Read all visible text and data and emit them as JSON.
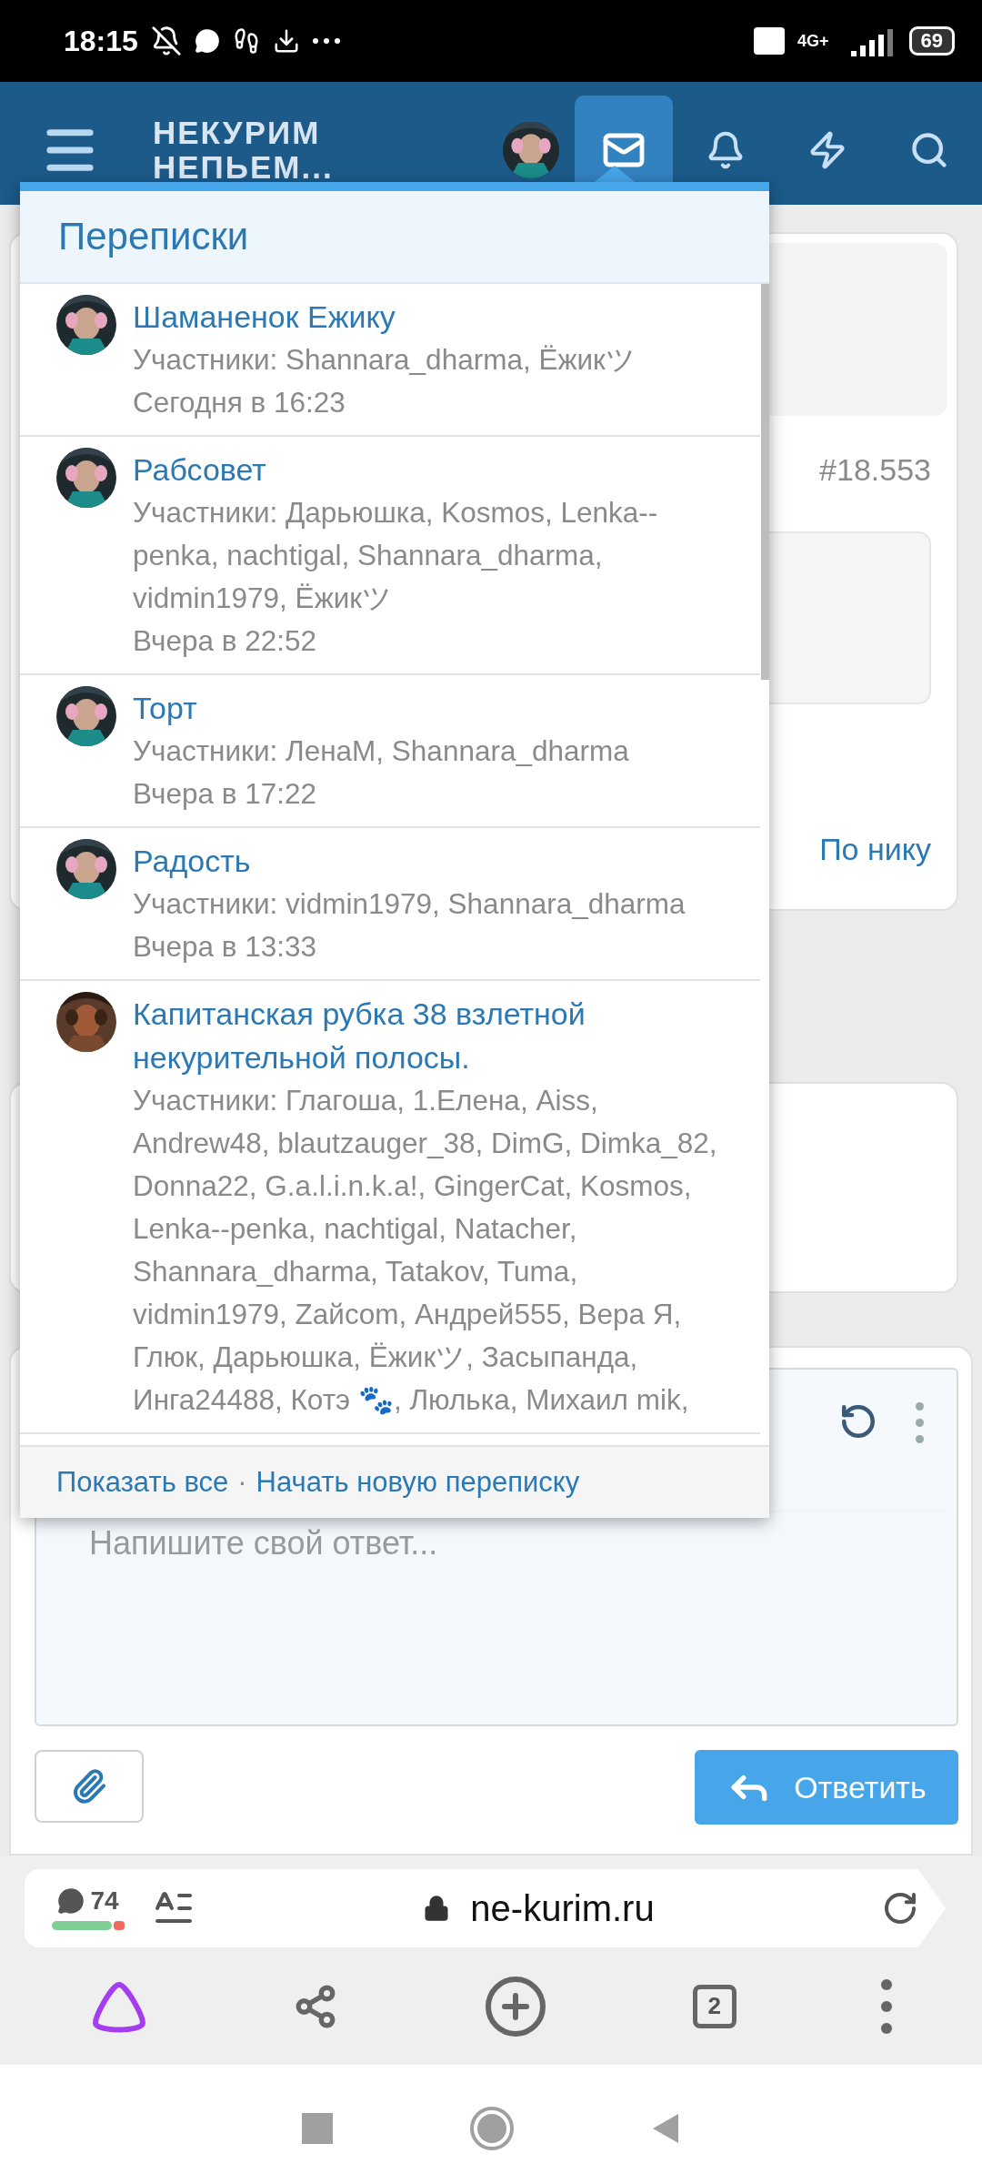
{
  "status_bar": {
    "time": "18:15",
    "network": "4G+",
    "battery": "69"
  },
  "header": {
    "logo_lines": [
      "НЕКУРИМ",
      "НЕПЬЕМ..."
    ],
    "nav": [
      {
        "kind": "avatar",
        "selected": false
      },
      {
        "kind": "mail",
        "selected": true
      },
      {
        "kind": "bell",
        "selected": false
      },
      {
        "kind": "bolt",
        "selected": false
      },
      {
        "kind": "search",
        "selected": false
      }
    ]
  },
  "page": {
    "post_number": "#18.553",
    "search_link": "По нику",
    "editor": {
      "placeholder": "Напишите свой ответ..."
    },
    "reply_button": "Ответить"
  },
  "conversations_menu": {
    "title": "Переписки",
    "conversations": [
      {
        "title": "Шаманенок Ежику",
        "participants": "Участники: Shannara_dharma, Ёжикツ",
        "time": "Сегодня в 16:23"
      },
      {
        "title": "Рабсовет",
        "participants": "Участники: Дарьюшка, Kosmos, Lenka--penka, nachtigal, Shannara_dharma, vidmin1979, Ёжикツ",
        "time": "Вчера в 22:52"
      },
      {
        "title": "Торт",
        "participants": "Участники: ЛенаМ, Shannara_dharma",
        "time": "Вчера в 17:22"
      },
      {
        "title": "Радость",
        "participants": "Участники: vidmin1979, Shannara_dharma",
        "time": "Вчера в 13:33"
      },
      {
        "title": "Капитанская рубка 38 взлетной некурительной полосы.",
        "participants": "Участники: Глагоша, 1.Елена, Aiss, Andrew48, blautzauger_38, DimG, Dimka_82, Donna22, G.a.l.i.n.k.a!, GingerCat, Kosmos, Lenka--penka, nachtigal, Natacher, Shannara_dharma, Tatakov, Tuma, vidmin1979, Zайсom, Андрей555, Вера Я, Глюк, Дарьюшка, Ёжикツ, Засыпанда, Инга24488, Котэ 🐾, Люлька, Михаил mik,"
      }
    ],
    "footer_links": [
      "Показать все",
      "Начать новую переписку"
    ],
    "separator": "·"
  },
  "browser": {
    "comments_count": "74",
    "url": "ne-kurim.ru",
    "tabs_count": "2"
  }
}
